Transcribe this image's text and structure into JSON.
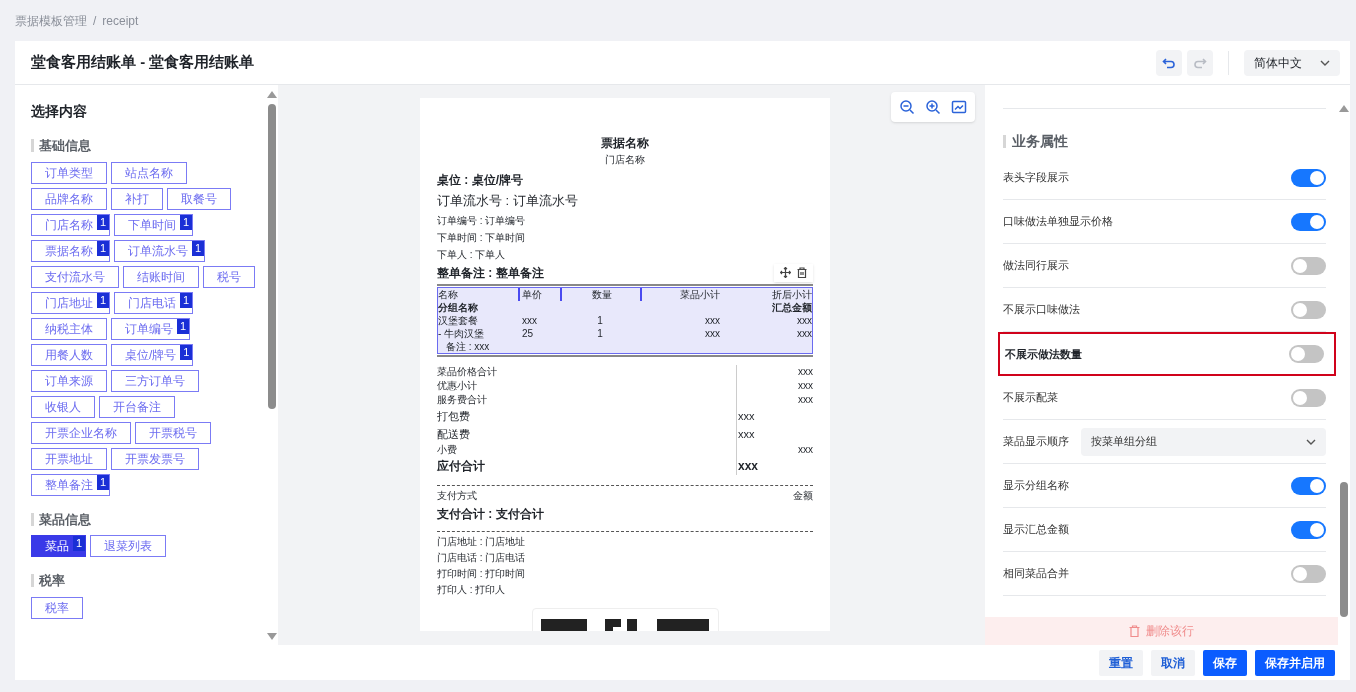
{
  "breadcrumb": {
    "separator": "/",
    "items": [
      {
        "label": "票据模板管理"
      },
      {
        "label": "receipt"
      }
    ]
  },
  "header": {
    "title": "堂食客用结账单 - 堂食客用结账单",
    "undo_disabled": false,
    "redo_disabled": true,
    "language": "简体中文"
  },
  "left_panel": {
    "title": "选择内容",
    "sections": [
      {
        "title": "基础信息",
        "tags": [
          {
            "label": "订单类型",
            "selected": false
          },
          {
            "label": "站点名称",
            "selected": false
          },
          {
            "label": "品牌名称",
            "selected": false
          },
          {
            "label": "补打",
            "selected": false
          },
          {
            "label": "取餐号",
            "selected": false
          },
          {
            "label": "门店名称",
            "badge": "1",
            "selected": false
          },
          {
            "label": "下单时间",
            "badge": "1",
            "selected": false
          },
          {
            "label": "票据名称",
            "badge": "1",
            "selected": false
          },
          {
            "label": "订单流水号",
            "badge": "1",
            "selected": false
          },
          {
            "label": "支付流水号",
            "selected": false
          },
          {
            "label": "结账时间",
            "selected": false
          },
          {
            "label": "税号",
            "selected": false
          },
          {
            "label": "门店地址",
            "badge": "1",
            "selected": false
          },
          {
            "label": "门店电话",
            "badge": "1",
            "selected": false
          },
          {
            "label": "纳税主体",
            "selected": false
          },
          {
            "label": "订单编号",
            "badge": "1",
            "selected": false
          },
          {
            "label": "用餐人数",
            "selected": false
          },
          {
            "label": "桌位/牌号",
            "badge": "1",
            "selected": false
          },
          {
            "label": "订单来源",
            "selected": false
          },
          {
            "label": "三方订单号",
            "selected": false
          },
          {
            "label": "收银人",
            "selected": false
          },
          {
            "label": "开台备注",
            "selected": false
          },
          {
            "label": "开票企业名称",
            "selected": false
          },
          {
            "label": "开票税号",
            "selected": false
          },
          {
            "label": "开票地址",
            "selected": false
          },
          {
            "label": "开票发票号",
            "selected": false
          },
          {
            "label": "整单备注",
            "badge": "1",
            "selected": false
          }
        ]
      },
      {
        "title": "菜品信息",
        "tags": [
          {
            "label": "菜品",
            "badge": "1",
            "selected": true
          },
          {
            "label": "退菜列表",
            "selected": false
          }
        ]
      },
      {
        "title": "税率",
        "tags": [
          {
            "label": "税率",
            "selected": false
          }
        ]
      }
    ]
  },
  "receipt": {
    "header_lines": [
      {
        "kind": "title",
        "text": "票据名称"
      },
      {
        "kind": "subtitle",
        "text": "门店名称"
      },
      {
        "kind": "bold",
        "text": "桌位 : 桌位/牌号"
      },
      {
        "kind": "large",
        "text": "订单流水号 : 订单流水号"
      },
      {
        "kind": "small",
        "text": "订单编号 : 订单编号"
      },
      {
        "kind": "small",
        "text": "下单时间 : 下单时间"
      },
      {
        "kind": "small",
        "text": "下单人 : 下单人"
      },
      {
        "kind": "bold",
        "text": "整单备注 : 整单备注"
      }
    ],
    "items_table": {
      "columns": [
        "名称",
        "单价",
        "数量",
        "菜品小计",
        "折后小计"
      ],
      "group_row": [
        "分组名称",
        "汇总金额"
      ],
      "rows": [
        [
          "汉堡套餐",
          "xxx",
          "1",
          "xxx",
          "xxx"
        ],
        [
          "- 牛肉汉堡",
          "25",
          "1",
          "xxx",
          "xxx"
        ]
      ],
      "note": "备注 : xxx"
    },
    "totals": [
      {
        "kind": "small",
        "label": "菜品价格合计",
        "value": "xxx"
      },
      {
        "kind": "small",
        "label": "优惠小计",
        "value": "xxx"
      },
      {
        "kind": "small",
        "label": "服务费合计",
        "value": "xxx"
      },
      {
        "kind": "large",
        "label": "打包费",
        "value": "xxx"
      },
      {
        "kind": "large",
        "label": "配送费",
        "value": "xxx"
      },
      {
        "kind": "small",
        "label": "小费",
        "value": "xxx"
      },
      {
        "kind": "bold",
        "label": "应付合计",
        "value": "xxx"
      }
    ],
    "payment": {
      "method_label": "支付方式",
      "amount_label": "金额",
      "total": "支付合计 : 支付合计"
    },
    "footer_lines": [
      "门店地址 : 门店地址",
      "门店电话 : 门店电话",
      "打印时间 : 打印时间",
      "打印人 : 打印人"
    ]
  },
  "right_panel": {
    "section_title": "业务属性",
    "settings": [
      {
        "kind": "toggle",
        "label": "表头字段展示",
        "on": true,
        "highlighted": false
      },
      {
        "kind": "toggle",
        "label": "口味做法单独显示价格",
        "on": true,
        "highlighted": false
      },
      {
        "kind": "toggle",
        "label": "做法同行展示",
        "on": false,
        "highlighted": false
      },
      {
        "kind": "toggle",
        "label": "不展示口味做法",
        "on": false,
        "highlighted": false
      },
      {
        "kind": "toggle",
        "label": "不展示做法数量",
        "on": false,
        "highlighted": true
      },
      {
        "kind": "toggle",
        "label": "不展示配菜",
        "on": false,
        "highlighted": false
      },
      {
        "kind": "select",
        "label": "菜品显示顺序",
        "value": "按菜单组分组"
      },
      {
        "kind": "toggle",
        "label": "显示分组名称",
        "on": true,
        "highlighted": false
      },
      {
        "kind": "toggle",
        "label": "显示汇总金额",
        "on": true,
        "highlighted": false
      },
      {
        "kind": "toggle",
        "label": "相同菜品合并",
        "on": false,
        "highlighted": false
      }
    ],
    "delete_label": "删除该行"
  },
  "footer_buttons": [
    {
      "kind": "secondary",
      "label": "重置"
    },
    {
      "kind": "secondary",
      "label": "取消"
    },
    {
      "kind": "primary",
      "label": "保存"
    },
    {
      "kind": "primary",
      "label": "保存并启用"
    }
  ]
}
